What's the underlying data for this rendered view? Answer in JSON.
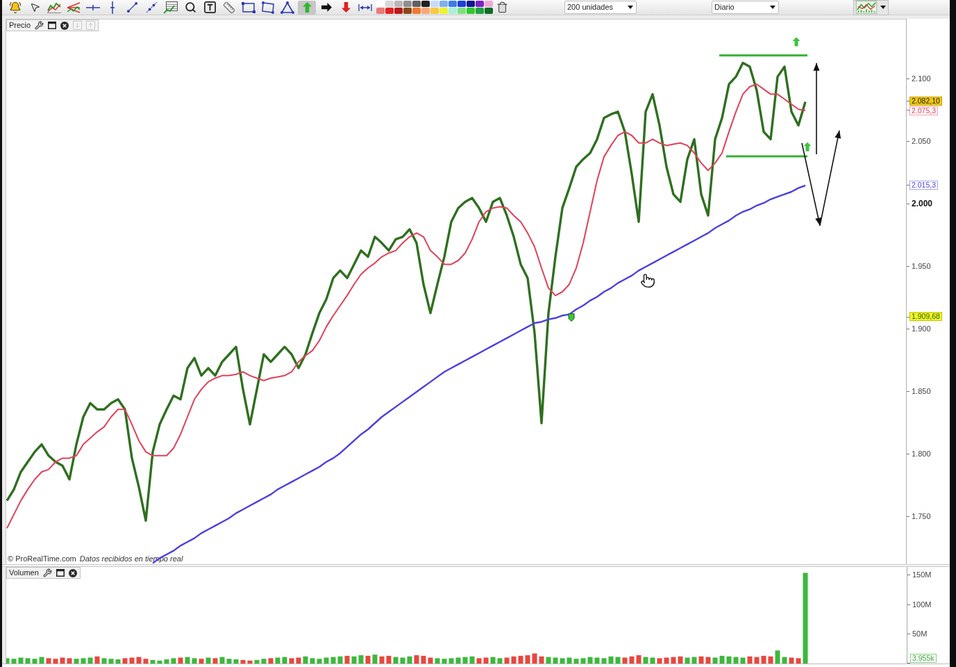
{
  "toolbar": {
    "tools": [
      {
        "selected": false
      },
      {
        "selected": false
      },
      {
        "selected": false
      },
      {
        "selected": false
      },
      {
        "selected": false
      },
      {
        "selected": false
      },
      {
        "selected": false
      },
      {
        "selected": false
      },
      {
        "selected": false
      },
      {
        "selected": false
      },
      {
        "selected": false
      },
      {
        "selected": false
      },
      {
        "selected": false
      },
      {
        "selected": false
      },
      {
        "selected": false
      },
      {
        "selected": true
      },
      {
        "selected": false
      },
      {
        "selected": false
      },
      {
        "selected": false
      }
    ],
    "palette": [
      {
        "color": "#ffffff"
      },
      {
        "color": "#d8d8d8"
      },
      {
        "color": "#b8b8b8"
      },
      {
        "color": "#909090"
      },
      {
        "color": "#606060"
      },
      {
        "color": "#202020"
      },
      {
        "color": "#c8dcf8"
      },
      {
        "color": "#7fb0f0"
      },
      {
        "color": "#3b7de8"
      },
      {
        "color": "#1f3fd8"
      },
      {
        "color": "#101890"
      },
      {
        "color": "#7a22c8"
      },
      {
        "color": "#f0a8d8"
      },
      {
        "color": "#e87a7a"
      },
      {
        "color": "#e02424"
      },
      {
        "color": "#b81c1c"
      },
      {
        "color": "#8a4a1a"
      },
      {
        "color": "#f07a30"
      },
      {
        "color": "#f8a878"
      },
      {
        "color": "#f8c840"
      },
      {
        "color": "#f0f030"
      },
      {
        "color": "#a8f0d8"
      },
      {
        "color": "#7ee07e"
      },
      {
        "color": "#2ec82e"
      },
      {
        "color": "#1ea040"
      },
      {
        "color": "#106a28"
      }
    ],
    "dropdowns": [
      {
        "value": "200 unidades"
      },
      {
        "value": "Diario"
      }
    ]
  },
  "price_panel": {
    "title": "Precio",
    "tools": [
      {
        "disabled": false
      },
      {
        "disabled": false
      },
      {
        "disabled": false
      },
      {
        "disabled": true
      },
      {
        "disabled": true
      }
    ],
    "chart_data": {
      "type": "line",
      "categories": [
        null,
        null,
        null,
        null,
        null,
        null,
        null,
        null,
        null,
        null,
        null,
        null,
        null,
        null,
        null,
        null,
        null,
        null,
        null,
        null,
        null,
        null,
        null,
        null,
        null,
        null,
        null,
        null,
        null,
        null,
        null,
        null,
        null,
        null,
        null,
        null,
        null,
        null,
        null,
        null,
        null,
        null,
        null,
        null,
        null,
        null,
        null,
        null,
        null,
        null,
        null,
        null,
        null,
        null,
        null,
        null,
        null,
        null,
        null,
        null,
        null,
        null,
        null,
        null,
        null,
        null,
        null,
        null,
        null,
        null,
        null,
        null,
        null,
        null,
        null,
        null,
        null,
        null,
        null,
        null,
        null,
        null,
        null,
        null,
        null,
        null,
        null,
        null,
        null,
        null,
        null,
        null,
        null,
        null,
        null,
        null,
        null,
        null,
        null,
        null,
        null,
        null,
        null,
        null,
        null,
        null,
        null,
        null,
        null,
        null,
        null,
        null,
        null,
        null,
        null,
        null
      ],
      "ylim": [
        1712.2,
        2147.8
      ],
      "yticks": [
        {
          "value": 2100,
          "label": "2.100"
        },
        {
          "value": 2050,
          "label": "2.050"
        },
        {
          "value": 2000,
          "label": "2.000"
        },
        {
          "value": 1950,
          "label": "1.950"
        },
        {
          "value": 1900,
          "label": "1.900"
        },
        {
          "value": 1850,
          "label": "1.850"
        },
        {
          "value": 1800,
          "label": "1.800"
        },
        {
          "value": 1750,
          "label": "1.750"
        }
      ],
      "series": [
        {
          "color": "#2f6f1f",
          "values": [
            1763,
            1772,
            1786,
            1794,
            1802,
            1808,
            1799,
            1794,
            1791,
            1780,
            1808,
            1830,
            1841,
            1836,
            1836,
            1841,
            1844,
            1836,
            1797,
            1774,
            1747,
            1802,
            1824,
            1836,
            1847,
            1844,
            1869,
            1877,
            1863,
            1869,
            1863,
            1874,
            1880,
            1886,
            1852,
            1824,
            1852,
            1880,
            1874,
            1880,
            1886,
            1880,
            1869,
            1880,
            1897,
            1913,
            1924,
            1941,
            1947,
            1941,
            1952,
            1963,
            1958,
            1974,
            1969,
            1963,
            1972,
            1974,
            1980,
            1969,
            1936,
            1913,
            1936,
            1958,
            1986,
            1997,
            2002,
            2005,
            1997,
            1986,
            2002,
            2005,
            1991,
            1974,
            1952,
            1941,
            1897,
            1825,
            1913,
            1958,
            1997,
            2013,
            2030,
            2036,
            2041,
            2052,
            2069,
            2072,
            2074,
            2058,
            2024,
            1986,
            2074,
            2088,
            2063,
            2030,
            2008,
            2002,
            2036,
            2052,
            2008,
            1991,
            2052,
            2069,
            2096,
            2102,
            2113,
            2110,
            2091,
            2058,
            2052,
            2102,
            2110,
            2074,
            2063,
            2082
          ]
        },
        {
          "color": "#e0405a",
          "values": [
            1741,
            1752,
            1763,
            1772,
            1780,
            1786,
            1788,
            1794,
            1797,
            1797,
            1799,
            1808,
            1813,
            1818,
            1822,
            1830,
            1836,
            1836,
            1824,
            1811,
            1802,
            1799,
            1799,
            1799,
            1805,
            1816,
            1830,
            1844,
            1852,
            1858,
            1861,
            1863,
            1863,
            1864,
            1866,
            1863,
            1861,
            1859,
            1861,
            1862,
            1863,
            1866,
            1874,
            1879,
            1883,
            1891,
            1902,
            1911,
            1919,
            1927,
            1936,
            1944,
            1949,
            1953,
            1958,
            1961,
            1963,
            1969,
            1974,
            1977,
            1974,
            1963,
            1958,
            1952,
            1952,
            1955,
            1961,
            1972,
            1986,
            1994,
            1997,
            1998,
            1997,
            1991,
            1986,
            1977,
            1966,
            1949,
            1933,
            1927,
            1930,
            1936,
            1949,
            1969,
            1994,
            2019,
            2038,
            2047,
            2055,
            2058,
            2055,
            2049,
            2049,
            2052,
            2049,
            2047,
            2048,
            2049,
            2047,
            2041,
            2033,
            2027,
            2033,
            2041,
            2058,
            2074,
            2088,
            2094,
            2096,
            2092,
            2088,
            2088,
            2084,
            2080,
            2076,
            2075
          ]
        },
        {
          "color": "#4b3fe0",
          "values": [
            null,
            null,
            null,
            null,
            null,
            null,
            null,
            null,
            null,
            null,
            null,
            null,
            null,
            null,
            null,
            null,
            null,
            null,
            null,
            null,
            null,
            1713,
            1717,
            1720,
            1723,
            1727,
            1730,
            1733,
            1737,
            1740,
            1743,
            1746,
            1749,
            1753,
            1756,
            1759,
            1762,
            1765,
            1768,
            1772,
            1775,
            1778,
            1781,
            1784,
            1787,
            1790,
            1794,
            1797,
            1801,
            1806,
            1811,
            1816,
            1820,
            1825,
            1830,
            1834,
            1838,
            1842,
            1846,
            1850,
            1854,
            1858,
            1862,
            1866,
            1869,
            1872,
            1875,
            1878,
            1881,
            1884,
            1887,
            1890,
            1893,
            1896,
            1899,
            1902,
            1905,
            1906,
            1908,
            1909,
            1911,
            1912,
            1916,
            1919,
            1923,
            1926,
            1930,
            1933,
            1937,
            1940,
            1943,
            1947,
            1950,
            1953,
            1956,
            1959,
            1962,
            1965,
            1968,
            1971,
            1974,
            1977,
            1981,
            1984,
            1987,
            1991,
            1994,
            1996,
            1999,
            2001,
            2004,
            2006,
            2008,
            2010,
            2013,
            2015
          ]
        }
      ]
    },
    "axis_badges": [
      {
        "text": "2.082,10",
        "kind": "last"
      },
      {
        "text": "2.075,3",
        "kind": "short_average"
      },
      {
        "text": "2.015,3",
        "kind": "long_average"
      },
      {
        "text": "1.909,68",
        "kind": "marker"
      }
    ],
    "footer": {
      "copyright": "© ProRealTime.com",
      "notice": "Datos recibidos en tiempo real"
    }
  },
  "volume_panel": {
    "title": "Volumen",
    "tools": [
      {
        "disabled": false
      },
      {
        "disabled": false
      },
      {
        "disabled": false
      }
    ],
    "axis_labels": [
      "150M",
      "100M",
      "50M"
    ],
    "axis_badges": [
      {
        "text": "3.955k",
        "kind": "volume"
      }
    ]
  }
}
